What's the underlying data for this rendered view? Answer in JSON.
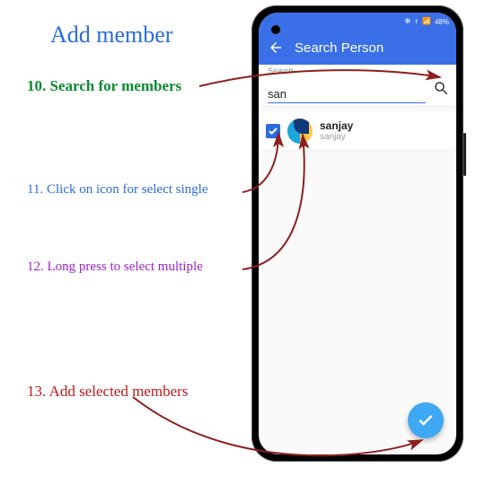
{
  "title": "Add member",
  "steps": {
    "s10": "10. Search for members",
    "s11": "11. Click on icon for select single",
    "s12": "12. Long press to select multiple",
    "s13": "13. Add selected members"
  },
  "phone": {
    "status": {
      "battery": "48%"
    },
    "appbar": {
      "title": "Search Person"
    },
    "search": {
      "label": "Search",
      "value": "san"
    },
    "result": {
      "name": "sanjay",
      "sub": "sanjay",
      "checked": true
    },
    "fab_icon": "check-icon"
  },
  "colors": {
    "accent": "#3a6fe8",
    "fab": "#3fa8f4",
    "arrow": "#8e1f1f"
  }
}
